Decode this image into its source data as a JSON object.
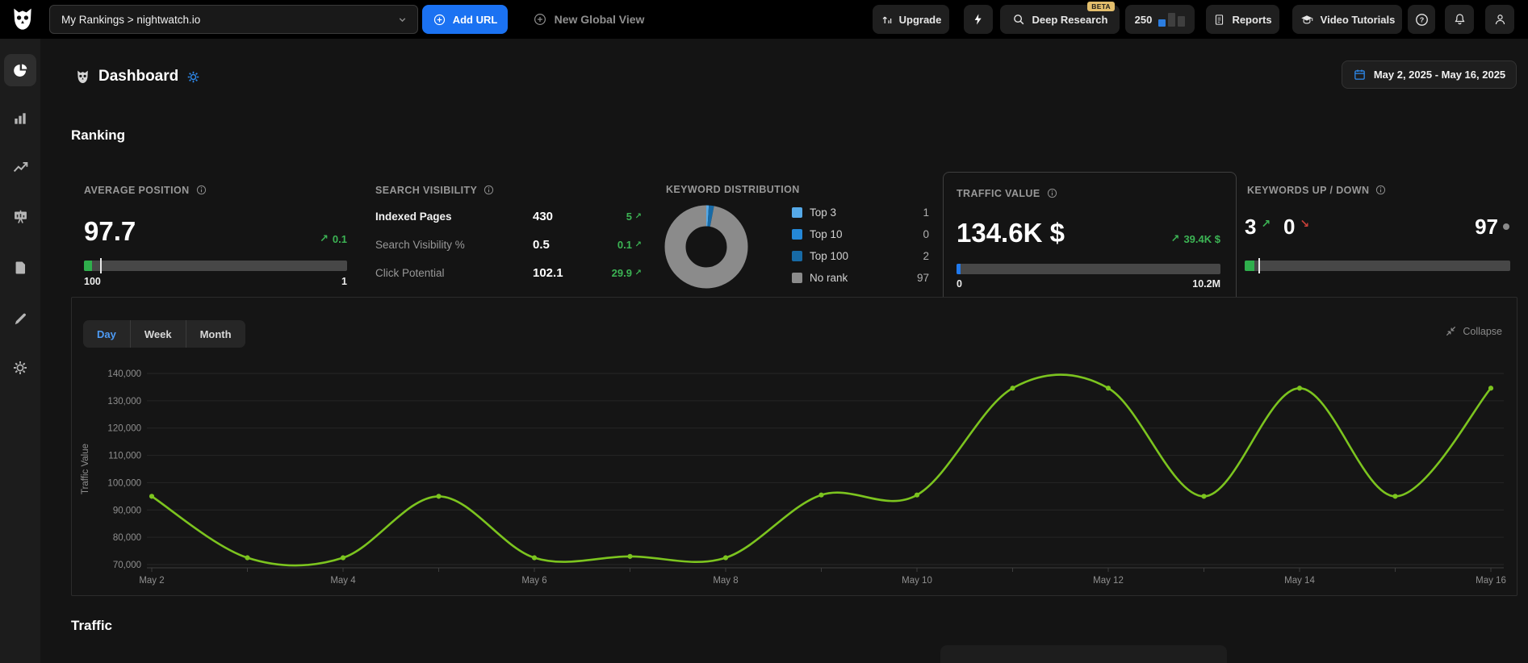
{
  "topbar": {
    "project_selector": "My Rankings > nightwatch.io",
    "add_url_label": "Add URL",
    "new_global_view_label": "New Global View",
    "upgrade_label": "Upgrade",
    "deep_research_label": "Deep Research",
    "beta_badge": "BETA",
    "credits": "250",
    "reports_label": "Reports",
    "video_tutorials_label": "Video Tutorials"
  },
  "header": {
    "title": "Dashboard",
    "date_range": "May 2, 2025 - May 16, 2025"
  },
  "sections": {
    "ranking_title": "Ranking",
    "traffic_title": "Traffic"
  },
  "icons": {
    "up": "↗",
    "down": "↘"
  },
  "cards": {
    "average_position": {
      "title": "AVERAGE POSITION",
      "value": "97.7",
      "change": "0.1",
      "scale_left": "100",
      "scale_right": "1",
      "bar": {
        "fill_percent": 3,
        "marker_percent": 6.2,
        "fill_color": "#2faf4c"
      }
    },
    "search_visibility": {
      "title": "SEARCH VISIBILITY",
      "rows": [
        {
          "label": "Indexed Pages",
          "value": "430",
          "change": "5"
        },
        {
          "label": "Search Visibility %",
          "value": "0.5",
          "change": "0.1"
        },
        {
          "label": "Click Potential",
          "value": "102.1",
          "change": "29.9"
        }
      ]
    },
    "keyword_distribution": {
      "title": "KEYWORD DISTRIBUTION",
      "legend": [
        {
          "label": "Top 3",
          "value": "1",
          "color": "#55a9e8"
        },
        {
          "label": "Top 10",
          "value": "0",
          "color": "#2488d8"
        },
        {
          "label": "Top 100",
          "value": "2",
          "color": "#176aa6"
        },
        {
          "label": "No rank",
          "value": "97",
          "color": "#8b8b8b"
        }
      ]
    },
    "traffic_value": {
      "title": "TRAFFIC VALUE",
      "value": "134.6K $",
      "change": "39.4K $",
      "scale_left": "0",
      "scale_right": "10.2M",
      "bar": {
        "fill_percent": 1.5,
        "fill_color": "#2079ec"
      }
    },
    "keywords_up_down": {
      "title": "KEYWORDS UP / DOWN",
      "up_value": "3",
      "down_value": "0",
      "no_change_value": "97",
      "bar": {
        "fill_percent": 3.6,
        "marker_percent": 5.2,
        "fill_color": "#2faf4c"
      }
    }
  },
  "chart_panel": {
    "tabs": [
      {
        "label": "Day"
      },
      {
        "label": "Week"
      },
      {
        "label": "Month"
      }
    ],
    "active_tab": "Day",
    "collapse_label": "Collapse"
  },
  "chart_data": {
    "type": "line",
    "title": "",
    "xlabel": "",
    "ylabel": "Traffic Value",
    "x": [
      "May 2",
      "May 3",
      "May 4",
      "May 5",
      "May 6",
      "May 7",
      "May 8",
      "May 9",
      "May 10",
      "May 11",
      "May 12",
      "May 13",
      "May 14",
      "May 15",
      "May 16"
    ],
    "values": [
      95000,
      72500,
      72500,
      95000,
      72500,
      73000,
      72500,
      95500,
      95500,
      134600,
      134600,
      95000,
      134600,
      95000,
      134600
    ],
    "ylim": [
      70000,
      140000
    ],
    "ytick_step": 10000,
    "x_label_every": 2,
    "line_color": "#7cc41f",
    "grid": true,
    "legend_position": "none"
  }
}
